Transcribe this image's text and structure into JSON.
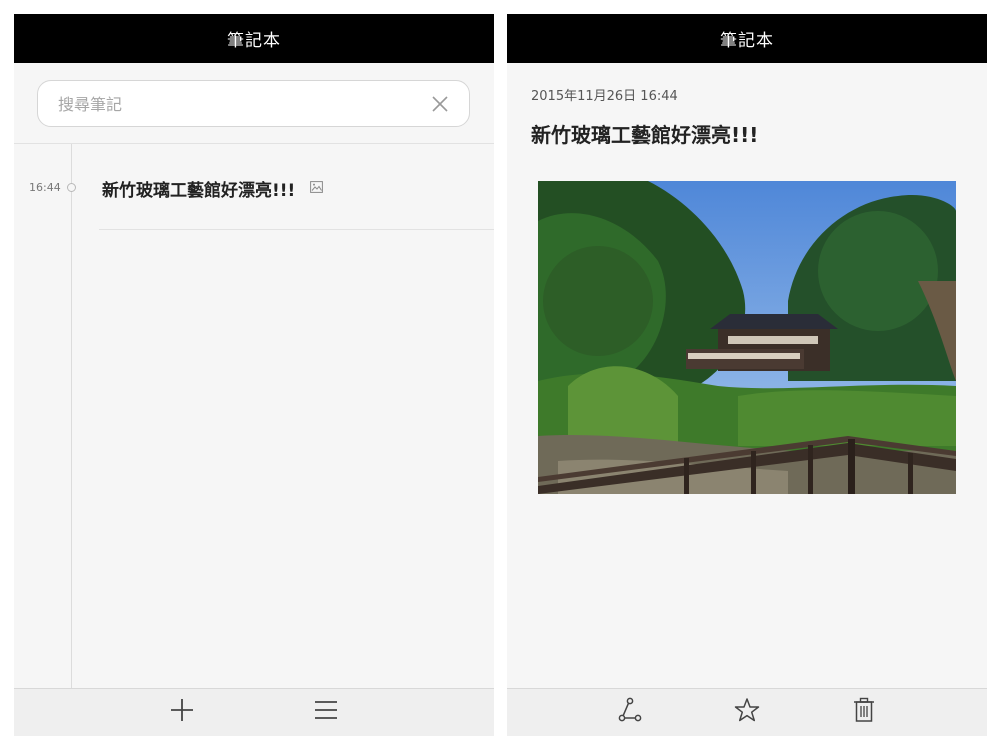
{
  "left_screen": {
    "title": "筆記本",
    "search": {
      "placeholder": "搜尋筆記",
      "value": ""
    },
    "notes": [
      {
        "time": "16:44",
        "title": "新竹玻璃工藝館好漂亮!!!",
        "has_image": true
      }
    ],
    "bottom_bar": [
      {
        "icon": "plus-icon",
        "label": "新增筆記"
      },
      {
        "icon": "menu-icon",
        "label": "選單"
      }
    ]
  },
  "right_screen": {
    "title": "筆記本",
    "date": "2015年11月26日 16:44",
    "note_title": "新竹玻璃工藝館好漂亮!!!",
    "image_icon": "photo-image",
    "bottom_bar": [
      {
        "icon": "share-icon",
        "label": "分享"
      },
      {
        "icon": "star-icon",
        "label": "我的最愛"
      },
      {
        "icon": "trash-icon",
        "label": "刪除"
      }
    ]
  },
  "colors": {
    "titlebar": "#000000",
    "background": "#f6f6f6",
    "bottom_bar": "#efefef",
    "text": "#222222"
  }
}
